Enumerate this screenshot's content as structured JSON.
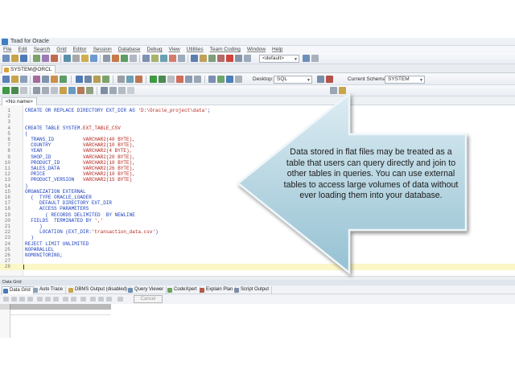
{
  "window": {
    "title": "Toad for Oracle"
  },
  "menu": [
    "File",
    "Edit",
    "Search",
    "Grid",
    "Editor",
    "Session",
    "Database",
    "Debug",
    "View",
    "Utilities",
    "Team Coding",
    "Window",
    "Help"
  ],
  "toolbar": {
    "profile_combo": "<default>",
    "desktop_label": "Desktop:",
    "desktop_value": "SQL",
    "schema_label": "Current Schema:",
    "schema_value": "SYSTEM"
  },
  "connection_tab": "SYSTEM@ORCL",
  "editor_tab": "<No name>",
  "editor_lines": [
    [
      [
        "kw",
        "CREATE OR REPLACE DIRECTORY "
      ],
      [
        "pl",
        "EXT_DIR "
      ],
      [
        "kw",
        "AS "
      ],
      [
        "st",
        "'D:\\Oracle_project\\data'"
      ],
      [
        "pl",
        ";"
      ]
    ],
    [],
    [],
    [
      [
        "kw",
        "CREATE TABLE "
      ],
      [
        "pl",
        "SYSTEM."
      ],
      [
        "ty",
        "EXT_TABLE_CSV"
      ]
    ],
    [
      [
        "pl",
        "("
      ]
    ],
    [
      [
        "pl",
        "  TRANS_ID          "
      ],
      [
        "ty",
        "VARCHAR2(40 BYTE),"
      ]
    ],
    [
      [
        "pl",
        "  COUNTRY           "
      ],
      [
        "ty",
        "VARCHAR2(10 BYTE),"
      ]
    ],
    [
      [
        "pl",
        "  YEAR              "
      ],
      [
        "ty",
        "VARCHAR2(4 BYTE),"
      ]
    ],
    [
      [
        "pl",
        "  SHOP_ID           "
      ],
      [
        "ty",
        "VARCHAR2(20 BYTE),"
      ]
    ],
    [
      [
        "pl",
        "  PRODUCT_ID        "
      ],
      [
        "ty",
        "VARCHAR2(10 BYTE),"
      ]
    ],
    [
      [
        "pl",
        "  SALES_DATA        "
      ],
      [
        "ty",
        "VARCHAR2(26 BYTE),"
      ]
    ],
    [
      [
        "pl",
        "  PRICE             "
      ],
      [
        "ty",
        "VARCHAR2(10 BYTE),"
      ]
    ],
    [
      [
        "pl",
        "  PRODUCT_VERSION   "
      ],
      [
        "ty",
        "VARCHAR2(15 BYTE)"
      ]
    ],
    [
      [
        "pl",
        ")"
      ]
    ],
    [
      [
        "kw",
        "ORGANIZATION EXTERNAL"
      ]
    ],
    [
      [
        "pl",
        "  (  "
      ],
      [
        "kw",
        "TYPE ORACLE_LOADER"
      ]
    ],
    [
      [
        "kw",
        "     DEFAULT DIRECTORY "
      ],
      [
        "pl",
        "EXT_DIR"
      ]
    ],
    [
      [
        "kw",
        "     ACCESS PARAMETERS"
      ]
    ],
    [
      [
        "pl",
        "       ( "
      ],
      [
        "kw",
        "RECORDS DELIMITED  BY NEWLINE"
      ]
    ],
    [
      [
        "kw",
        "  FIELDS  TERMINATED BY "
      ],
      [
        "st",
        "','"
      ]
    ],
    [
      [
        "pl",
        "     )"
      ]
    ],
    [
      [
        "kw",
        "     LOCATION "
      ],
      [
        "pl",
        "(EXT_DIR:"
      ],
      [
        "st",
        "'transaction_data.csv'"
      ],
      [
        "pl",
        ")"
      ]
    ],
    [
      [
        "pl",
        "  )"
      ]
    ],
    [
      [
        "kw",
        "REJECT LIMIT UNLIMITED"
      ]
    ],
    [
      [
        "kw",
        "NOPARALLEL"
      ]
    ],
    [
      [
        "kw",
        "NOMONITORING"
      ],
      [
        "pl",
        ";"
      ]
    ],
    [],
    []
  ],
  "panel_title": "Data Grid",
  "bottom_tabs": [
    {
      "label": "Data Grid",
      "color": "#4a78b5"
    },
    {
      "label": "Auto Trace",
      "color": "#8aa0b8"
    },
    {
      "label": "DBMS Output (disabled)",
      "color": "#c9a64a"
    },
    {
      "label": "Query Viewer",
      "color": "#6c8fb3"
    },
    {
      "label": "CodeXpert",
      "color": "#6aa35b"
    },
    {
      "label": "Explain Plan",
      "color": "#b55a4a"
    },
    {
      "label": "Script Output",
      "color": "#7b8ea6"
    }
  ],
  "grid_cancel": "Cancel",
  "callout": {
    "text": "Data stored in flat files may be treated as a table that users can query directly and join to other tables in queries. You can use external tables to access large volumes of data without ever loading them into your database."
  }
}
